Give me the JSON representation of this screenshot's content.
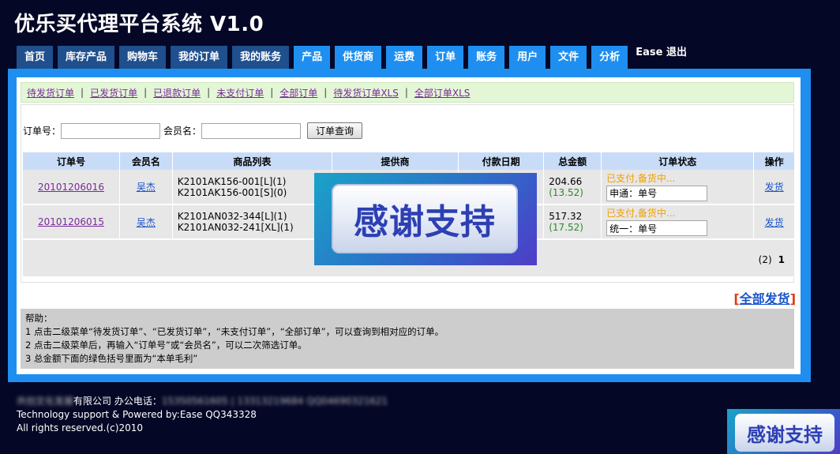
{
  "app": {
    "title": "优乐买代理平台系统 V1.0"
  },
  "nav": {
    "tabs": [
      {
        "label": "首页",
        "style": "dark"
      },
      {
        "label": "库存产品",
        "style": "dark"
      },
      {
        "label": "购物车",
        "style": "dark"
      },
      {
        "label": "我的订单",
        "style": "dark"
      },
      {
        "label": "我的账务",
        "style": "dark"
      },
      {
        "label": "产品",
        "style": "light"
      },
      {
        "label": "供货商",
        "style": "light"
      },
      {
        "label": "运费",
        "style": "light"
      },
      {
        "label": "订单",
        "style": "light"
      },
      {
        "label": "账务",
        "style": "light"
      },
      {
        "label": "用户",
        "style": "light"
      },
      {
        "label": "文件",
        "style": "light"
      },
      {
        "label": "分析",
        "style": "light"
      }
    ],
    "user": "Ease",
    "logout": "退出"
  },
  "subnav": {
    "items": [
      "待发货订单",
      "已发货订单",
      "已退款订单",
      "未支付订单",
      "全部订单",
      "待发货订单XLS",
      "全部订单XLS"
    ],
    "separator": "|"
  },
  "search": {
    "order_label": "订单号：",
    "member_label": "会员名：",
    "button": "订单查询",
    "order_value": "",
    "member_value": ""
  },
  "table": {
    "headers": [
      "订单号",
      "会员名",
      "商品列表",
      "提供商",
      "付款日期",
      "总金额",
      "订单状态",
      "操作"
    ],
    "rows": [
      {
        "order_no": "20101206016",
        "member": "吴杰",
        "items": [
          "K2101AK156-001[L](1)",
          "K2101AK156-001[S](0)"
        ],
        "supplier": "",
        "pay_date": "",
        "total": "204.66",
        "profit": "(13.52)",
        "status": "已支付,备货中...",
        "ship_value": "申通：单号",
        "action": "发货"
      },
      {
        "order_no": "20101206015",
        "member": "吴杰",
        "items": [
          "K2101AN032-344[L](1)",
          "K2101AN032-241[XL](1)"
        ],
        "supplier": "",
        "pay_date": "",
        "total": "517.32",
        "profit": "(17.52)",
        "status": "已支付,备货中...",
        "ship_value": "统一：单号",
        "action": "发货"
      }
    ],
    "pager": {
      "prev": "(2)",
      "current": "1"
    }
  },
  "ship_all": {
    "open": "[",
    "label": "全部发货",
    "close": "]"
  },
  "help": {
    "title": "帮助：",
    "lines": [
      "1 点击二级菜单“待发货订单”、“已发货订单”，“未支付订单”，“全部订单”，可以查询到相对应的订单。",
      "2 点击二级菜单后，再输入“订单号”或“会员名”，可以二次筛选订单。",
      "3 总金额下面的绿色括号里面为“本单毛利”"
    ]
  },
  "overlay": {
    "text": "感谢支持"
  },
  "footer": {
    "company_blurred": "共创文化发展",
    "company_suffix": "有限公司 办公电话：",
    "phones_blurred": "15350561605 | 13313219684 QQ04690321621",
    "line2": "Technology support & Powered by:Ease QQ343328",
    "line3": "All rights reserved.(c)2010"
  }
}
